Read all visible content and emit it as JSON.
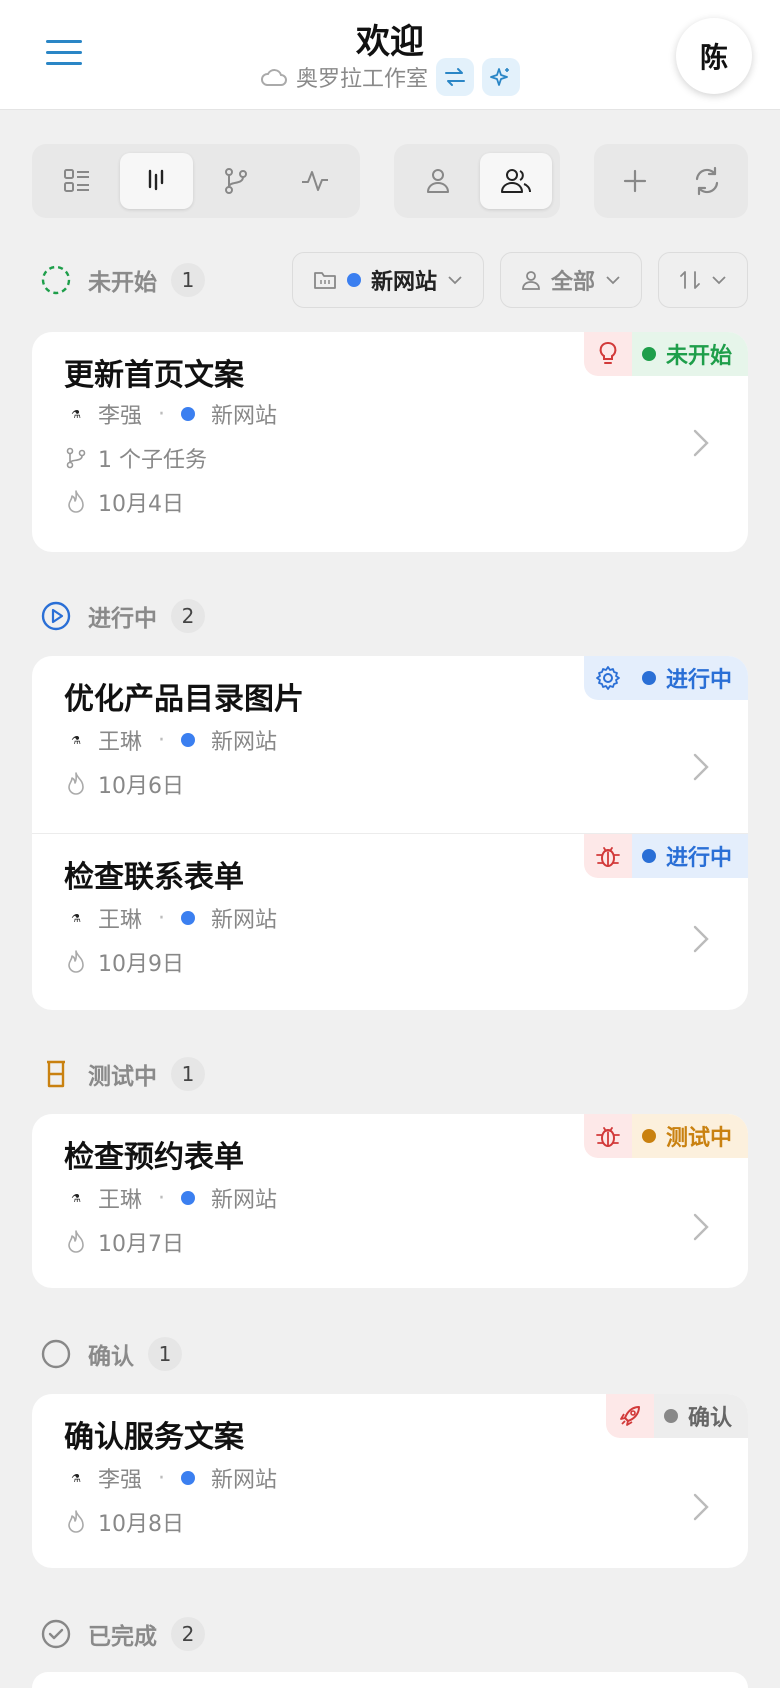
{
  "header": {
    "title": "欢迎",
    "workspace": "奥罗拉工作室",
    "avatar_initial": "陈"
  },
  "filters": {
    "project": "新网站",
    "assignee": "全部"
  },
  "sections": [
    {
      "label": "未开始",
      "count": "1"
    },
    {
      "label": "进行中",
      "count": "2"
    },
    {
      "label": "测试中",
      "count": "1"
    },
    {
      "label": "确认",
      "count": "1"
    },
    {
      "label": "已完成",
      "count": "2"
    }
  ],
  "tasks": [
    {
      "name": "更新首页文案",
      "assignee": "李强",
      "project": "新网站",
      "subtasks": "1 个子任务",
      "date": "10月4日",
      "status": "未开始",
      "status_icon": "lightbulb-icon"
    },
    {
      "name": "优化产品目录图片",
      "assignee": "王琳",
      "project": "新网站",
      "date": "10月6日",
      "status": "进行中",
      "status_icon": "gear-icon"
    },
    {
      "name": "检查联系表单",
      "assignee": "王琳",
      "project": "新网站",
      "date": "10月9日",
      "status": "进行中",
      "status_icon": "bug-icon"
    },
    {
      "name": "检查预约表单",
      "assignee": "王琳",
      "project": "新网站",
      "date": "10月7日",
      "status": "测试中",
      "status_icon": "bug-icon"
    },
    {
      "name": "确认服务文案",
      "assignee": "李强",
      "project": "新网站",
      "date": "10月8日",
      "status": "确认",
      "status_icon": "rocket-icon"
    }
  ],
  "colors": {
    "accent": "#2a86c6",
    "project_dot": "#3b7ff0",
    "status_not_started": "#1e9e4a",
    "status_in_progress": "#2a6fd6",
    "status_testing": "#c98110",
    "status_confirm": "#888888",
    "bug_red": "#d23a3a"
  }
}
